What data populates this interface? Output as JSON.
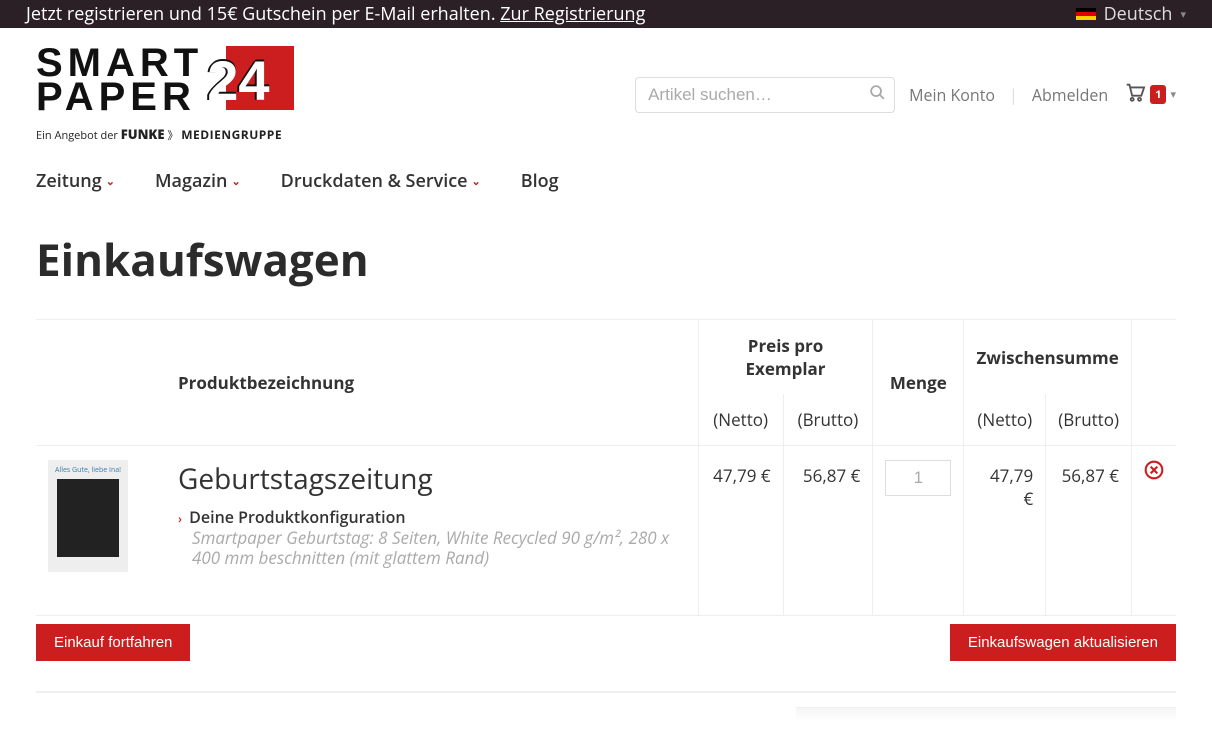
{
  "top_banner": {
    "text": "Jetzt registrieren und 15€ Gutschein per E-Mail erhalten. ",
    "link_label": "Zur Registrierung",
    "language_label": "Deutsch"
  },
  "logo": {
    "line1": "SMART",
    "line2": "PAPER",
    "number": "24",
    "sub_prefix": "Ein Angebot der ",
    "sub_brand": "FUNKE",
    "sub_group": "MEDIENGRUPPE"
  },
  "header": {
    "search_placeholder": "Artikel suchen…",
    "my_account": "Mein Konto",
    "logout": "Abmelden",
    "cart_count": "1"
  },
  "nav": {
    "items": [
      "Zeitung",
      "Magazin",
      "Druckdaten & Service",
      "Blog"
    ]
  },
  "page_title": "Einkaufswagen",
  "cart": {
    "columns": {
      "product": "Produktbezeichnung",
      "price_per_copy": "Preis pro Exemplar",
      "qty": "Menge",
      "subtotal": "Zwischensumme",
      "netto": "(Netto)",
      "brutto": "(Brutto)"
    },
    "item": {
      "thumb_caption": "Alles Gute, liebe Ina!",
      "name": "Geburtstagszeitung",
      "config_label": "Deine Produktkonfiguration",
      "config_detail": "Smartpaper Geburtstag: 8 Seiten, White Recycled 90 g/m², 280 x 400 mm beschnitten (mit glattem Rand)",
      "price_netto": "47,79 €",
      "price_brutto": "56,87 €",
      "qty": "1",
      "sub_netto": "47,79 €",
      "sub_brutto": "56,87 €"
    },
    "buttons": {
      "continue": "Einkauf fortfahren",
      "update": "Einkaufswagen aktualisieren"
    }
  }
}
